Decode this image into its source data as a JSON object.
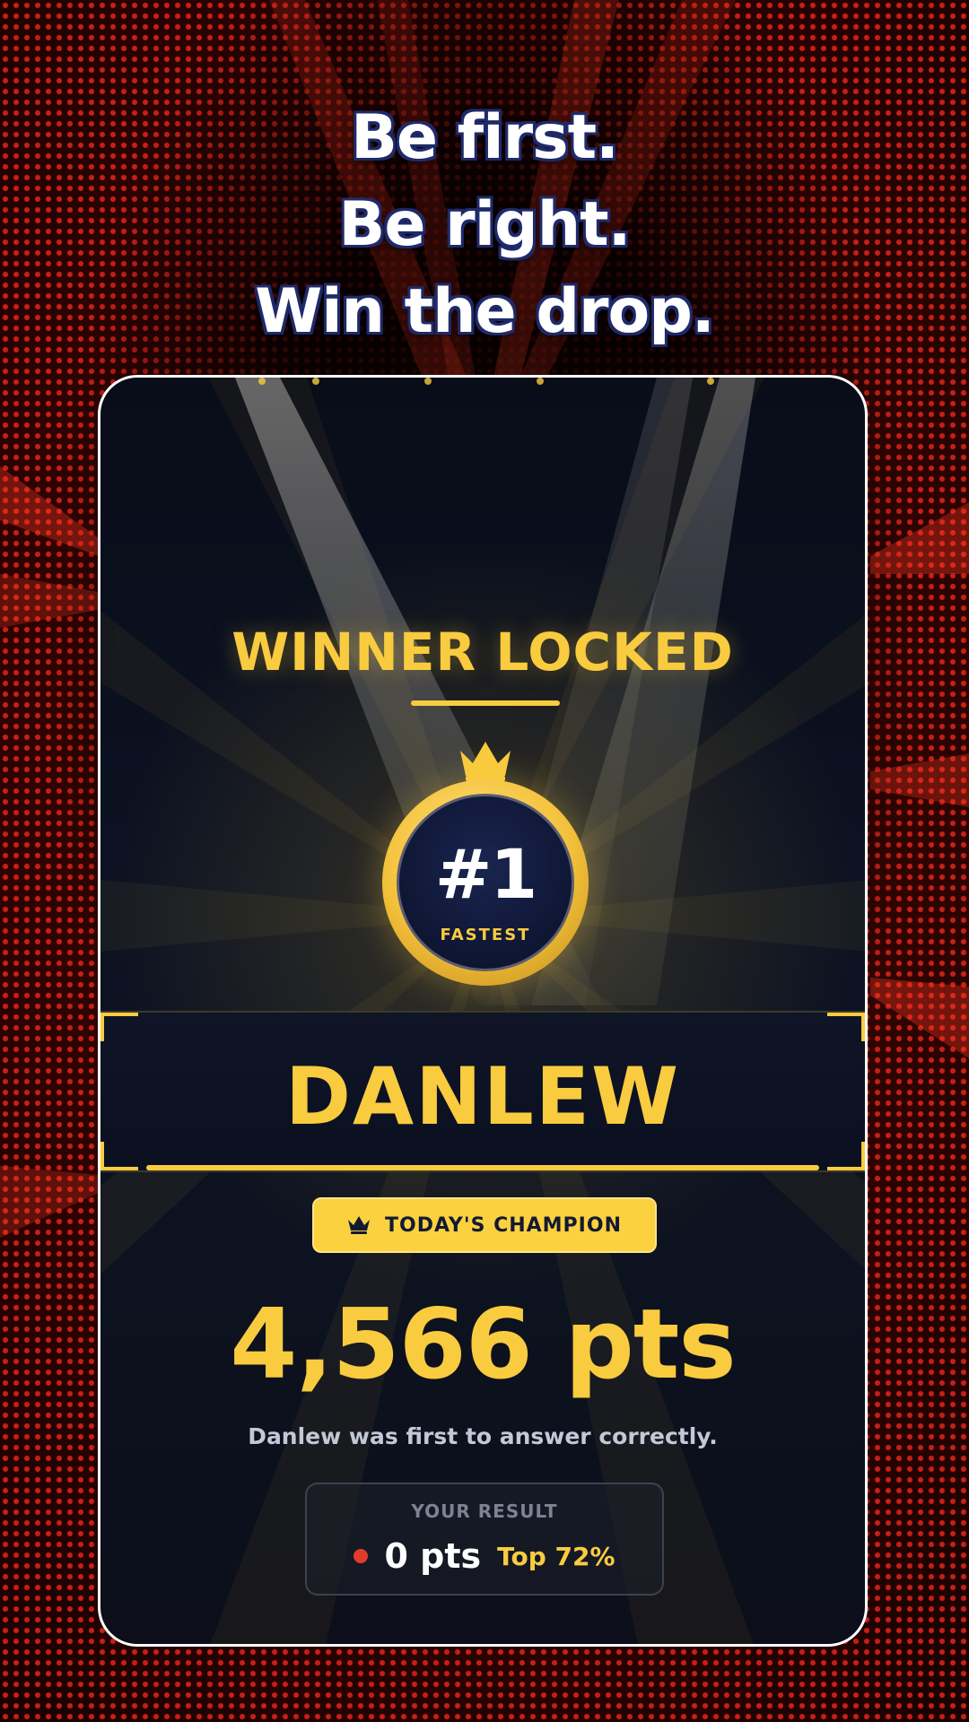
{
  "headline": {
    "line1": "Be first.",
    "line2": "Be right.",
    "line3": "Win the drop."
  },
  "card": {
    "title": "WINNER LOCKED",
    "medal": {
      "rank": "#1",
      "label": "FASTEST"
    },
    "winner_name": "DANLEW",
    "badge": {
      "icon": "crown-icon",
      "label": "TODAY'S CHAMPION"
    },
    "points": "4,566 pts",
    "description": "Danlew was first to answer correctly.",
    "your_result": {
      "label": "YOUR RESULT",
      "points": "0 pts",
      "rank": "Top 72%"
    }
  },
  "colors": {
    "gold": "#f9cb3f",
    "card_bg": "#0c1222",
    "red_dot": "#e23b2e",
    "headline_outline": "#1f2a6b"
  }
}
